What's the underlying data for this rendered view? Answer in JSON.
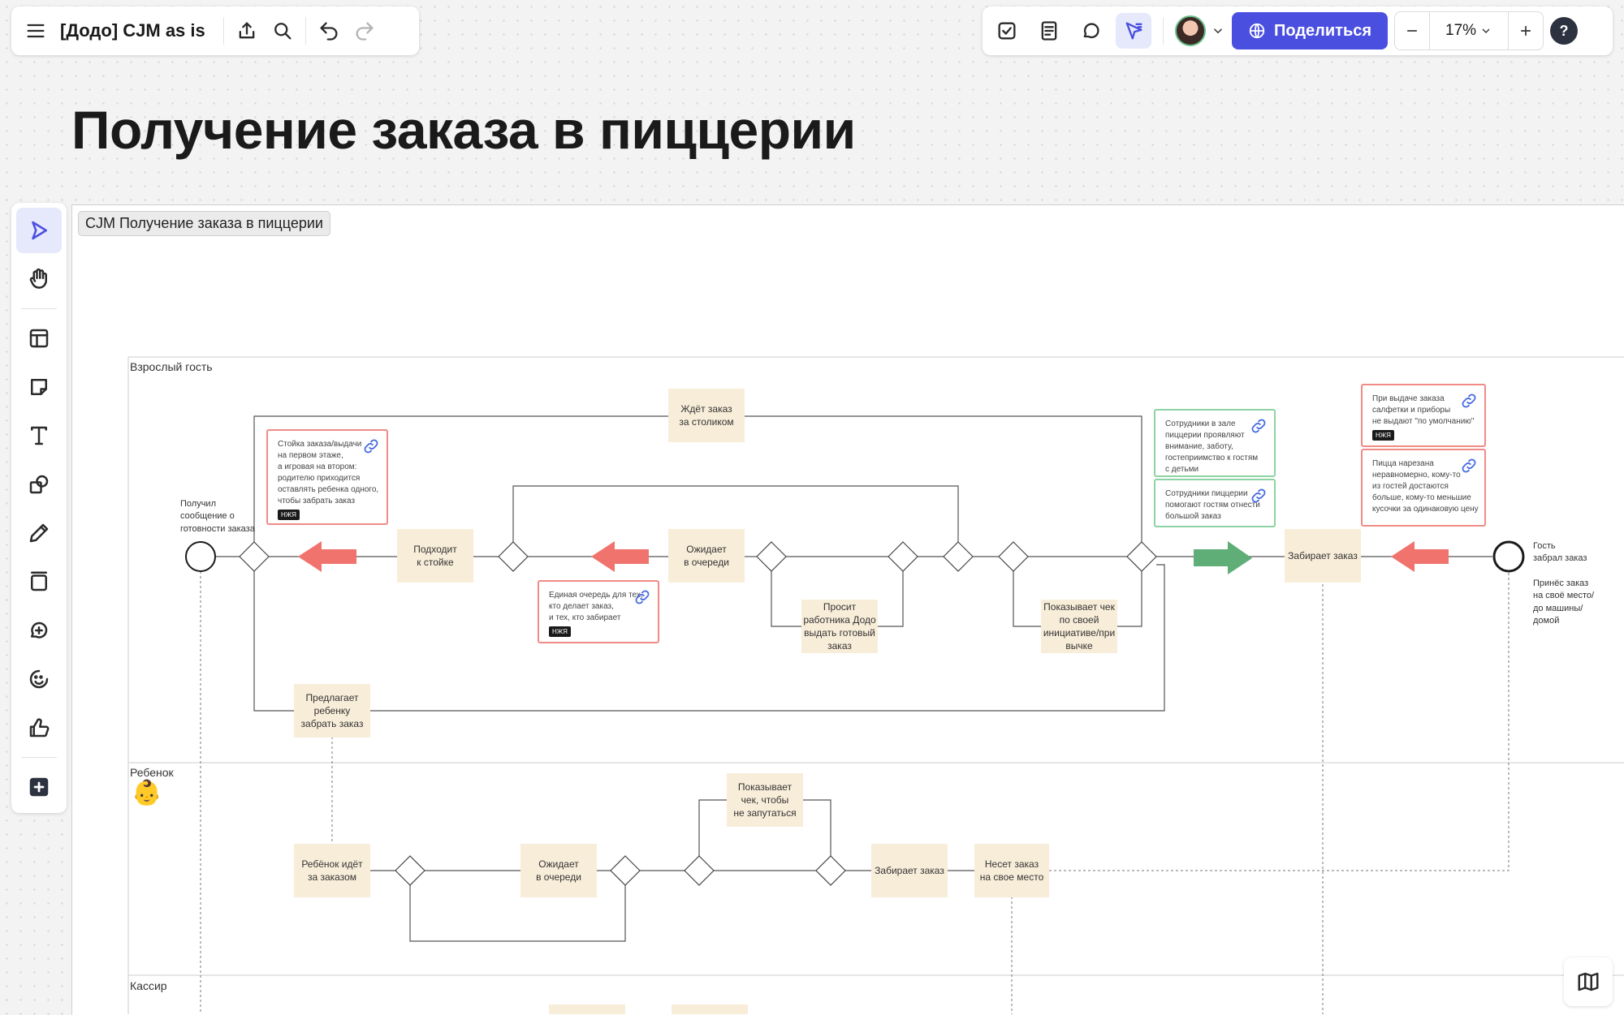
{
  "header": {
    "board_title": "[Додо] CJM as is",
    "share_label": "Поделиться",
    "zoom_level": "17%"
  },
  "page": {
    "title": "Получение заказа в пиццерии",
    "frame_label": "CJM Получение заказа в пиццерии"
  },
  "colors": {
    "accent": "#4a4fe0",
    "step_fill": "#f8edd9",
    "pain_red": "#f0746d",
    "gain_green": "#5fae77"
  },
  "lanes": {
    "adult": "Взрослый гость",
    "child": "Ребенок",
    "cashier": "Кассир",
    "child_emoji": "👶"
  },
  "adult_lane": {
    "start_text": "Получил\nсообщение о\nготовности заказа",
    "end_text": "Гость\nзабрал заказ",
    "end_text_2": "Принёс заказ\nна своё место/\nдо машины/\nдомой",
    "steps": {
      "waits_table": "Ждёт заказ\nза столиком",
      "approaches": "Подходит\nк стойке",
      "waits_queue": "Ожидает\nв очереди",
      "asks_worker": "Просит\nработника Додо\nвыдать готовый\nзаказ",
      "shows_receipt": "Показывает чек\nпо своей\nинициативе/при\nвычке",
      "picks_up": "Забирает заказ",
      "offers_child": "Предлагает\nребенку\nзабрать заказ"
    },
    "notes": {
      "counter": "Стойка заказа/выдачи\nна первом этаже,\nа игровая на втором:\nродителю приходится\nоставлять ребенка одного,\nчтобы забрать заказ",
      "queue": "Единая очередь для тех,\nкто делает заказ,\nи тех, кто забирает",
      "staff_attention": "Сотрудники в зале\nпиццерии проявляют\nвнимание, заботу,\nгостеприимство к гостям\nс детьми",
      "staff_help": "Сотрудники пиццерии\nпомогают гостям отнести\nбольшой заказ",
      "napkins": "При выдаче заказа\nсалфетки и приборы\nне выдают \"по умолчанию\"",
      "pizza_cut": "Пицца нарезана\nнеравномерно, кому-то\nиз гостей достаются\nбольше, кому-то меньшие\nкусочки за одинаковую цену",
      "tag": "НЖЯ"
    }
  },
  "child_lane": {
    "steps": {
      "goes": "Ребёнок идёт\nза заказом",
      "waits": "Ожидает\nв очереди",
      "shows_receipt": "Показывает\nчек, чтобы\nне запутаться",
      "picks_up": "Забирает заказ",
      "carries": "Несет заказ\nна свое место"
    }
  }
}
